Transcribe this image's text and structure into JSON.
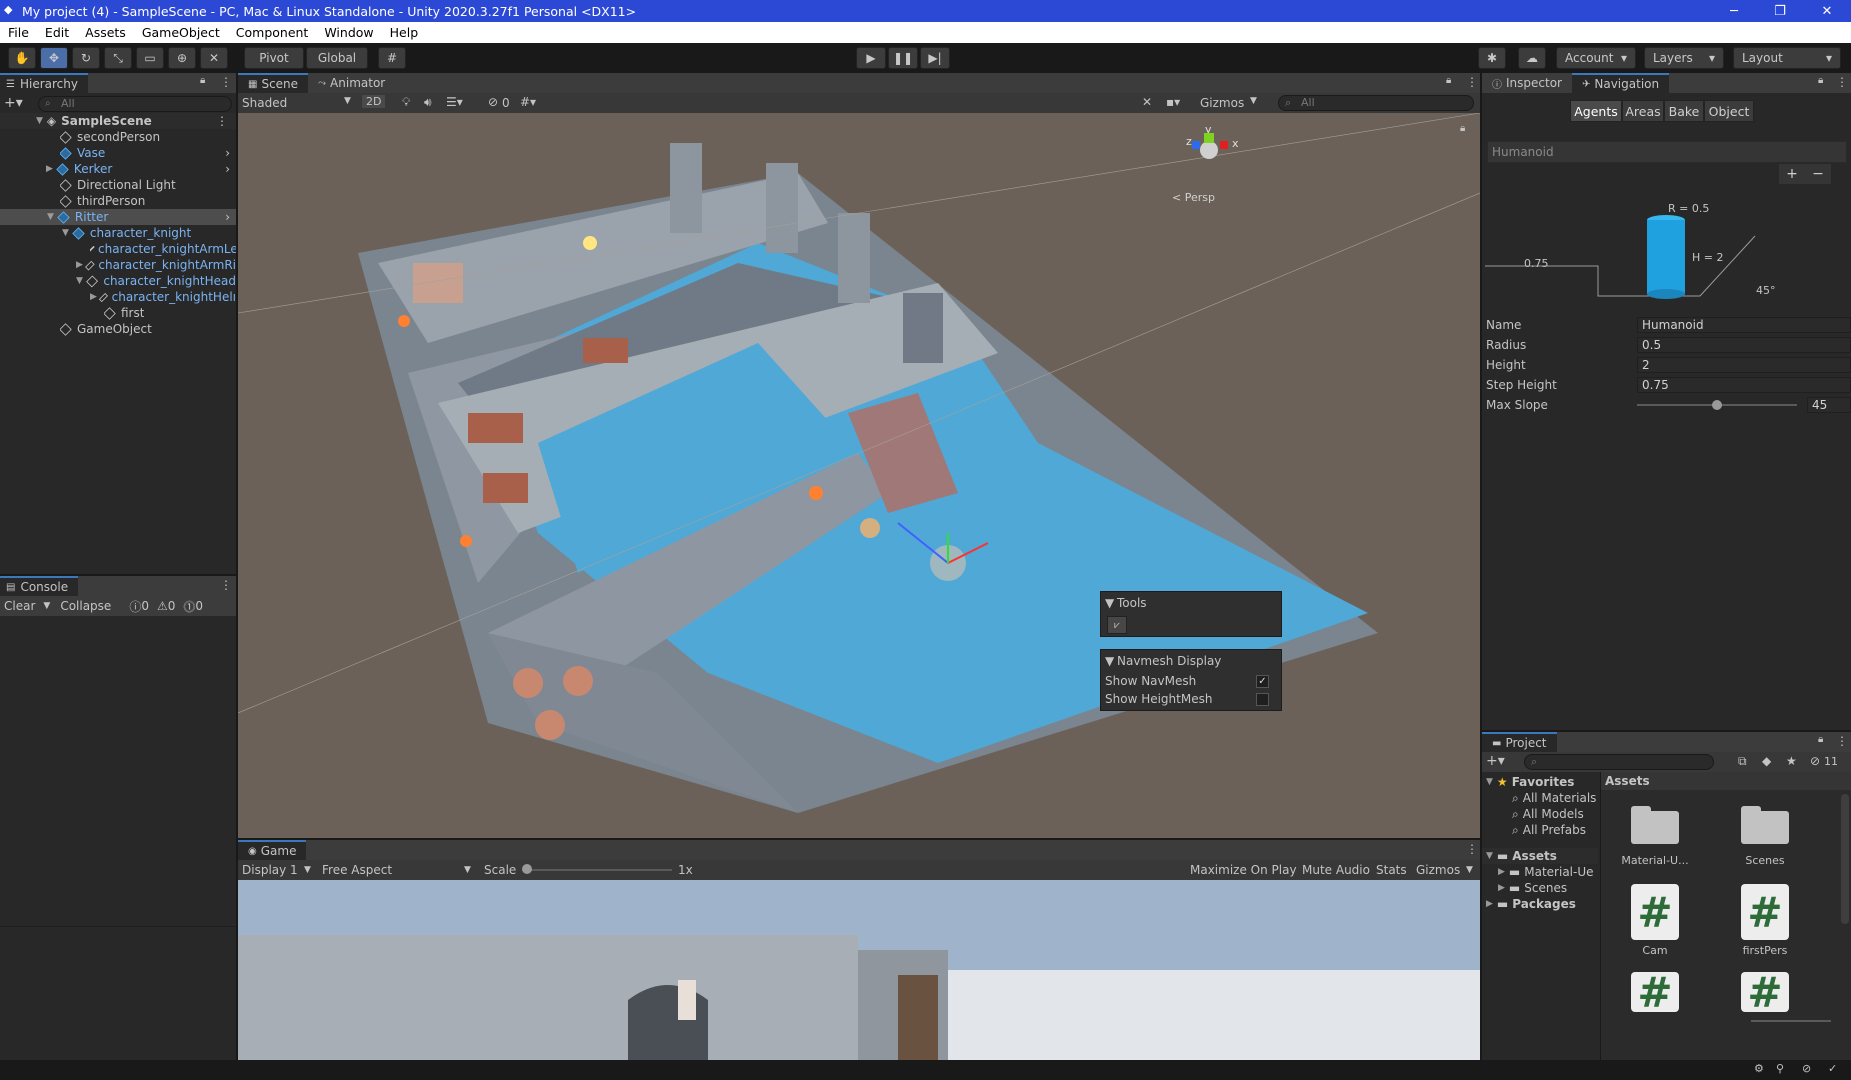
{
  "window": {
    "title": "My project (4) - SampleScene - PC, Mac & Linux Standalone - Unity 2020.3.27f1 Personal <DX11>"
  },
  "menu": [
    "File",
    "Edit",
    "Assets",
    "GameObject",
    "Component",
    "Window",
    "Help"
  ],
  "toolbar": {
    "pivot": "Pivot",
    "global": "Global",
    "account": "Account",
    "layers": "Layers",
    "layout": "Layout"
  },
  "hierarchy": {
    "tab": "Hierarchy",
    "search_placeholder": "All",
    "scene": "SampleScene",
    "items": [
      {
        "label": "secondPerson"
      },
      {
        "label": "Vase"
      },
      {
        "label": "Kerker"
      },
      {
        "label": "Directional Light"
      },
      {
        "label": "thirdPerson"
      },
      {
        "label": "Ritter"
      },
      {
        "label": "character_knight"
      },
      {
        "label": "character_knightArmLe"
      },
      {
        "label": "character_knightArmRi"
      },
      {
        "label": "character_knightHead"
      },
      {
        "label": "character_knightHelı"
      },
      {
        "label": "first"
      },
      {
        "label": "GameObject"
      }
    ]
  },
  "console": {
    "tab": "Console",
    "clear": "Clear",
    "collapse": "Collapse",
    "counts": [
      "0",
      "0",
      "0"
    ]
  },
  "scene": {
    "tabs": [
      "Scene",
      "Animator"
    ],
    "shading": "Shaded",
    "mode_2d": "2D",
    "hidden_count": "0",
    "gizmos": "Gizmos",
    "search_placeholder": "All",
    "persp": "< Persp",
    "axis": {
      "y": "y",
      "x": "x",
      "z": "z"
    },
    "tools_overlay": {
      "title": "Tools"
    },
    "navmesh_overlay": {
      "title": "Navmesh Display",
      "show_navmesh": "Show NavMesh",
      "show_heightmesh": "Show HeightMesh",
      "navmesh_checked": true,
      "heightmesh_checked": false
    }
  },
  "game": {
    "tab": "Game",
    "display": "Display 1",
    "aspect": "Free Aspect",
    "scale_label": "Scale",
    "scale_value": "1x",
    "maximize": "Maximize On Play",
    "mute": "Mute Audio",
    "stats": "Stats",
    "gizmos": "Gizmos"
  },
  "inspector": {
    "tabs": [
      "Inspector",
      "Navigation"
    ],
    "subtabs": [
      "Agents",
      "Areas",
      "Bake",
      "Object"
    ],
    "agent_type": "Humanoid",
    "diagram": {
      "r": "R = 0.5",
      "h": "H = 2",
      "step": "0.75",
      "slope": "45°"
    },
    "fields": [
      {
        "label": "Name",
        "value": "Humanoid"
      },
      {
        "label": "Radius",
        "value": "0.5"
      },
      {
        "label": "Height",
        "value": "2"
      },
      {
        "label": "Step Height",
        "value": "0.75"
      },
      {
        "label": "Max Slope",
        "value": "45"
      }
    ],
    "max_slope_fraction": 0.5
  },
  "project": {
    "tab": "Project",
    "hidden_count": "11",
    "favorites": "Favorites",
    "fav_items": [
      "All Materials",
      "All Models",
      "All Prefabs"
    ],
    "assets_root": "Assets",
    "asset_folders": [
      "Material-Ue",
      "Scenes"
    ],
    "packages": "Packages",
    "breadcrumb": "Assets",
    "grid": [
      {
        "label": "Material-U...",
        "kind": "folder"
      },
      {
        "label": "Scenes",
        "kind": "folder"
      },
      {
        "label": "Cam",
        "kind": "script"
      },
      {
        "label": "firstPers",
        "kind": "script"
      }
    ]
  },
  "colors": {
    "titlebar": "#2c49d6",
    "selection": "#3a79bb",
    "panel": "#282828",
    "navmesh": "#4fa8d6"
  }
}
